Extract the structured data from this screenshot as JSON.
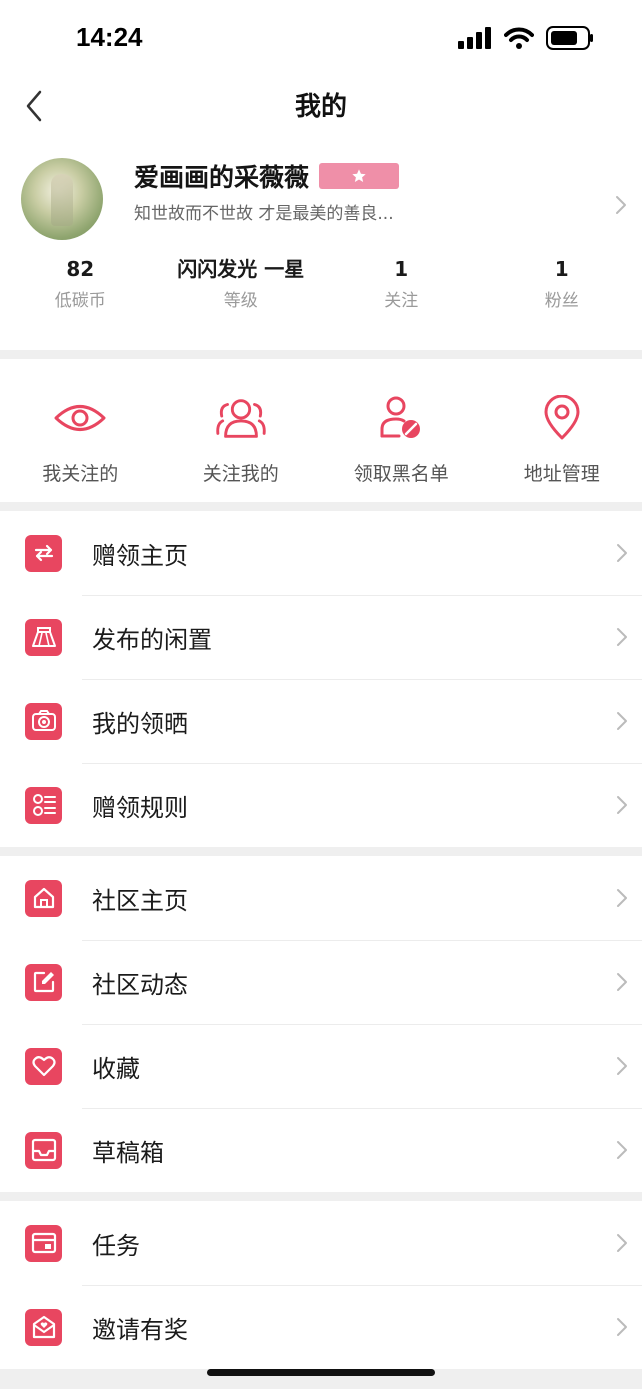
{
  "status_bar": {
    "time": "14:24"
  },
  "nav": {
    "title": "我的"
  },
  "profile": {
    "username": "爱画画的采薇薇",
    "bio": "知世故而不世故 才是最美的善良...",
    "stats": [
      {
        "value": "82",
        "label": "低碳币"
      },
      {
        "value": "闪闪发光 一星",
        "label": "等级"
      },
      {
        "value": "1",
        "label": "关注"
      },
      {
        "value": "1",
        "label": "粉丝"
      }
    ]
  },
  "quick_actions": [
    {
      "label": "我关注的",
      "icon": "eye-icon"
    },
    {
      "label": "关注我的",
      "icon": "users-icon"
    },
    {
      "label": "领取黑名单",
      "icon": "user-blocked-icon"
    },
    {
      "label": "地址管理",
      "icon": "location-pin-icon"
    }
  ],
  "sections": [
    [
      {
        "label": "赠领主页",
        "icon": "exchange-icon"
      },
      {
        "label": "发布的闲置",
        "icon": "skirt-icon"
      },
      {
        "label": "我的领晒",
        "icon": "camera-icon"
      },
      {
        "label": "赠领规则",
        "icon": "list-icon"
      }
    ],
    [
      {
        "label": "社区主页",
        "icon": "home-icon"
      },
      {
        "label": "社区动态",
        "icon": "edit-icon"
      },
      {
        "label": "收藏",
        "icon": "heart-icon"
      },
      {
        "label": "草稿箱",
        "icon": "inbox-icon"
      }
    ],
    [
      {
        "label": "任务",
        "icon": "task-card-icon"
      },
      {
        "label": "邀请有奖",
        "icon": "invite-mail-icon"
      }
    ]
  ],
  "colors": {
    "accent": "#e84660",
    "badge": "#ef8fa8"
  }
}
